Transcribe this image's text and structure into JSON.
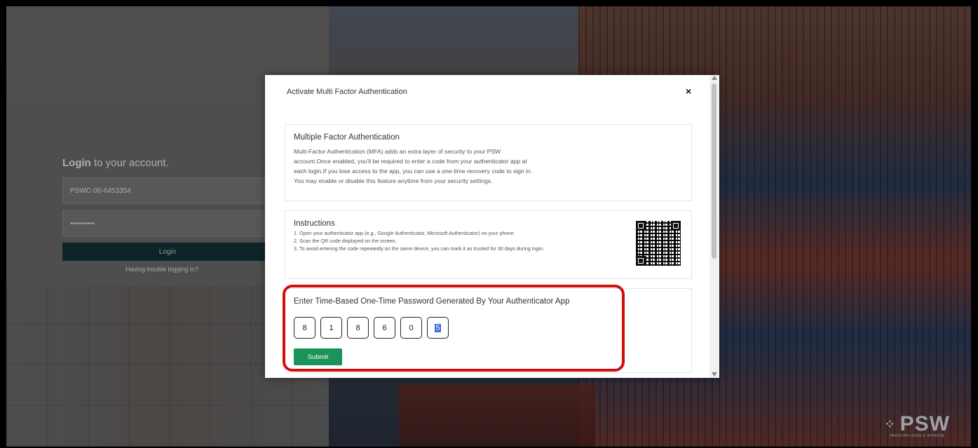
{
  "login": {
    "title_bold": "Login",
    "title_rest": " to your account.",
    "username": "PSWC-00-6453354",
    "password": "••••••••••",
    "login_button": "Login",
    "trouble_link": "Having trouble logging in?"
  },
  "logo": {
    "name": "PSW",
    "subtitle": "PAKISTAN SINGLE WINDOW"
  },
  "modal": {
    "title": "Activate Multi Factor Authentication",
    "close": "×",
    "mfa_card": {
      "title": "Multiple Factor Authentication",
      "lines": [
        "Multi-Factor Authentication (MFA) adds an extra layer of security to your PSW",
        "account.Once enabled, you'll be required to enter a code from your authenticator app at",
        "each login.If you lose access to the app, you can use a one-time recovery code to sign in.",
        "You may enable or disable this feature anytime from your security settings."
      ]
    },
    "instructions_card": {
      "title": "Instructions",
      "steps": [
        "1. Open your authenticator app (e.g., Google Authenticator, Microsoft Authenticator) on your phone.",
        "2. Scan the QR code displayed on the screen.",
        "3. To avoid entering the code repeatedly on the same device, you can mark it as trusted for 30 days during login."
      ]
    },
    "otp_card": {
      "title": "Enter Time-Based One-Time Password Generated By Your Authenticator App",
      "digits": [
        "8",
        "1",
        "8",
        "6",
        "0",
        "5"
      ],
      "submit": "Submit"
    }
  },
  "colors": {
    "submit": "#1a9457",
    "highlight": "#d10f0f",
    "login_button": "#13323a"
  },
  "icons": [
    "close-icon",
    "qr-code",
    "psw-logo-icon",
    "scroll-up-icon",
    "scroll-down-icon"
  ]
}
